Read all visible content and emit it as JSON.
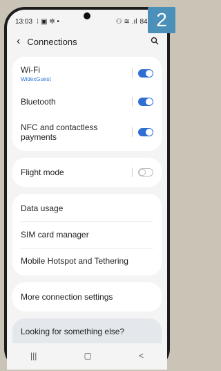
{
  "badge": "2",
  "status": {
    "time": "13:03",
    "battery": "84%"
  },
  "header": {
    "title": "Connections"
  },
  "rows": {
    "wifi": {
      "label": "Wi-Fi",
      "sub": "WidexGuest",
      "toggle": "on"
    },
    "bluetooth": {
      "label": "Bluetooth",
      "toggle": "on"
    },
    "nfc": {
      "label": "NFC and contactless payments",
      "toggle": "on"
    },
    "flight": {
      "label": "Flight mode",
      "toggle": "off"
    },
    "data_usage": {
      "label": "Data usage"
    },
    "sim": {
      "label": "SIM card manager"
    },
    "hotspot": {
      "label": "Mobile Hotspot and Tethering"
    },
    "more": {
      "label": "More connection settings"
    }
  },
  "footer": {
    "label": "Looking for something else?"
  },
  "nav": {
    "recents": "|||",
    "home": "▢",
    "back": "<"
  },
  "colors": {
    "accent": "#2f6fd3",
    "badge": "#4a90b8"
  }
}
